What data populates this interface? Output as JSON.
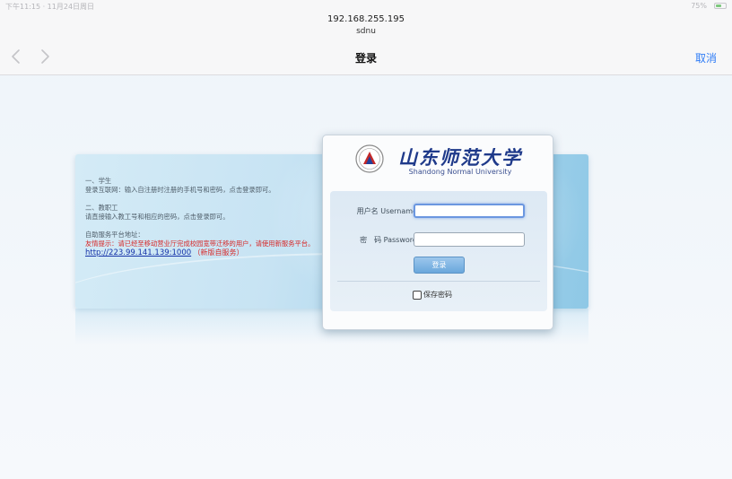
{
  "browser": {
    "status_time": "下午11:15 · 11月24日周日",
    "status_right": "75%",
    "url_host": "192.168.255.195",
    "url_title": "sdnu",
    "page_heading": "登录",
    "cancel_label": "取消",
    "accent_color": "#2f7cf6"
  },
  "info": {
    "section1_title": "一、学生",
    "section1_text": "登录互联网：输入自注册时注册的手机号和密码，点击登录即可。",
    "section2_title": "二、教职工",
    "section2_text": "请直接输入教工号和相应的密码，点击登录即可。",
    "selfservice_label": "自助服务平台地址：",
    "warning_text": "友情提示：请已经至移动营业厅完成校园宽带迁移的用户，请使用新服务平台。",
    "link_url": "http://223.99.141.139:1000",
    "link_suffix": "（新版自服务）",
    "warning_color": "#d72828"
  },
  "login": {
    "university_cn": "山东师范大学",
    "university_en": "Shandong Normal University",
    "username_label": "用户名 Username",
    "username_value": "",
    "password_label": "密　码 Password",
    "password_value": "",
    "login_button": "登录",
    "remember_label": "保存密码",
    "remember_checked": false
  }
}
